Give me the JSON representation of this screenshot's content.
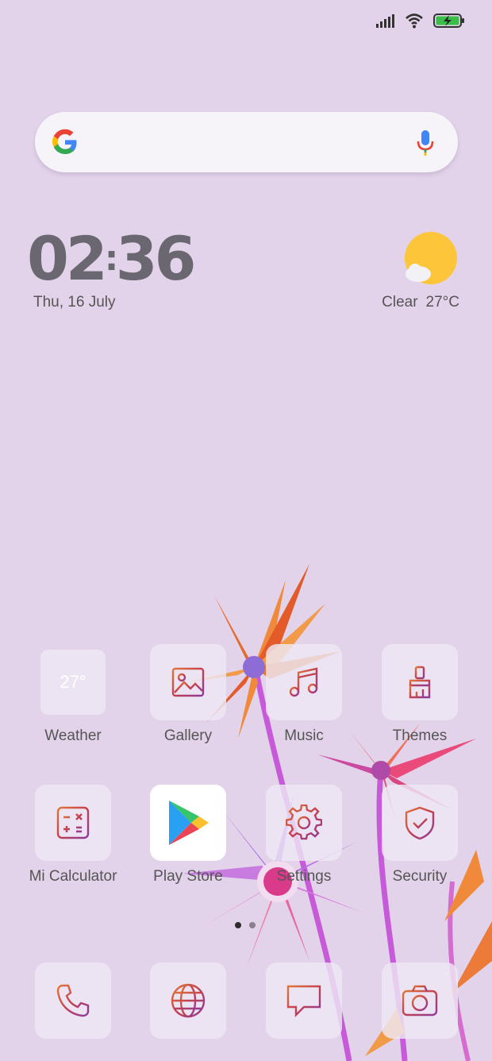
{
  "status_bar": {
    "signal_icon": "signal-icon",
    "wifi_icon": "wifi-icon",
    "battery_icon": "battery-charging-icon"
  },
  "search": {
    "logo": "google-g-icon",
    "mic": "mic-icon"
  },
  "clock": {
    "hours": "02",
    "minutes": "36",
    "date": "Thu, 16 July"
  },
  "weather_widget": {
    "condition": "Clear",
    "temp": "27°C"
  },
  "apps_row1": [
    {
      "label": "Weather",
      "tile_text": "27°"
    },
    {
      "label": "Gallery"
    },
    {
      "label": "Music"
    },
    {
      "label": "Themes"
    }
  ],
  "apps_row2": [
    {
      "label": "Mi Calculator"
    },
    {
      "label": "Play Store"
    },
    {
      "label": "Settings"
    },
    {
      "label": "Security"
    }
  ],
  "dock": [
    "phone-icon",
    "browser-globe-icon",
    "messages-icon",
    "camera-icon"
  ],
  "colors": {
    "background": "#e3d3ea",
    "icon_gradient_start": "#c9474f",
    "icon_gradient_end": "#8a3aa0"
  }
}
